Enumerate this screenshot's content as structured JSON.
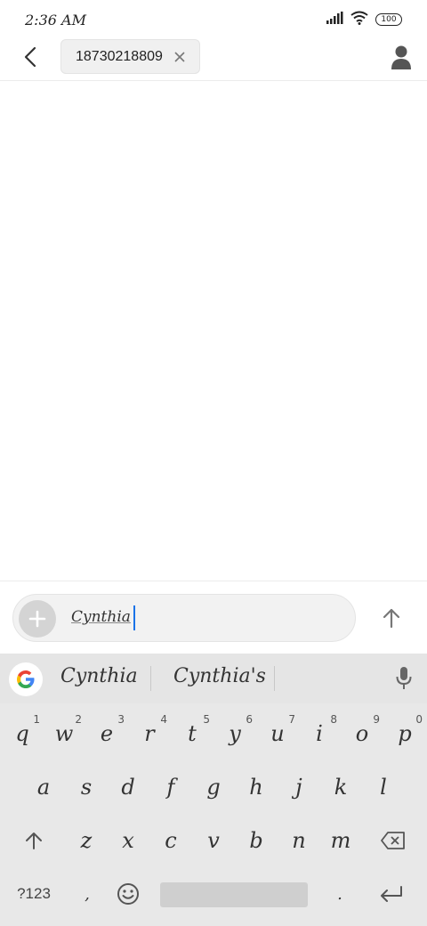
{
  "status_bar": {
    "time": "2:36 AM",
    "battery": "100",
    "icons": [
      "signal-icon",
      "wifi-icon",
      "battery-icon"
    ]
  },
  "header": {
    "back_icon": "back-arrow-icon",
    "recipient": "18730218809",
    "chip_close_icon": "close-icon",
    "contact_icon": "person-icon"
  },
  "compose": {
    "add_icon": "plus-icon",
    "text": "Cynthia",
    "send_icon": "arrow-up-icon"
  },
  "keyboard": {
    "suggestions": [
      "Cynthia",
      "Cynthia's"
    ],
    "row1": [
      {
        "key": "q",
        "num": "1"
      },
      {
        "key": "w",
        "num": "2"
      },
      {
        "key": "e",
        "num": "3"
      },
      {
        "key": "r",
        "num": "4"
      },
      {
        "key": "t",
        "num": "5"
      },
      {
        "key": "y",
        "num": "6"
      },
      {
        "key": "u",
        "num": "7"
      },
      {
        "key": "i",
        "num": "8"
      },
      {
        "key": "o",
        "num": "9"
      },
      {
        "key": "p",
        "num": "0"
      }
    ],
    "row2": [
      "a",
      "s",
      "d",
      "f",
      "g",
      "h",
      "j",
      "k",
      "l"
    ],
    "row3": [
      "z",
      "x",
      "c",
      "v",
      "b",
      "n",
      "m"
    ],
    "row4": {
      "symbols": "?123",
      "comma": ",",
      "period": "."
    },
    "accent_color": "#1a73e8"
  }
}
